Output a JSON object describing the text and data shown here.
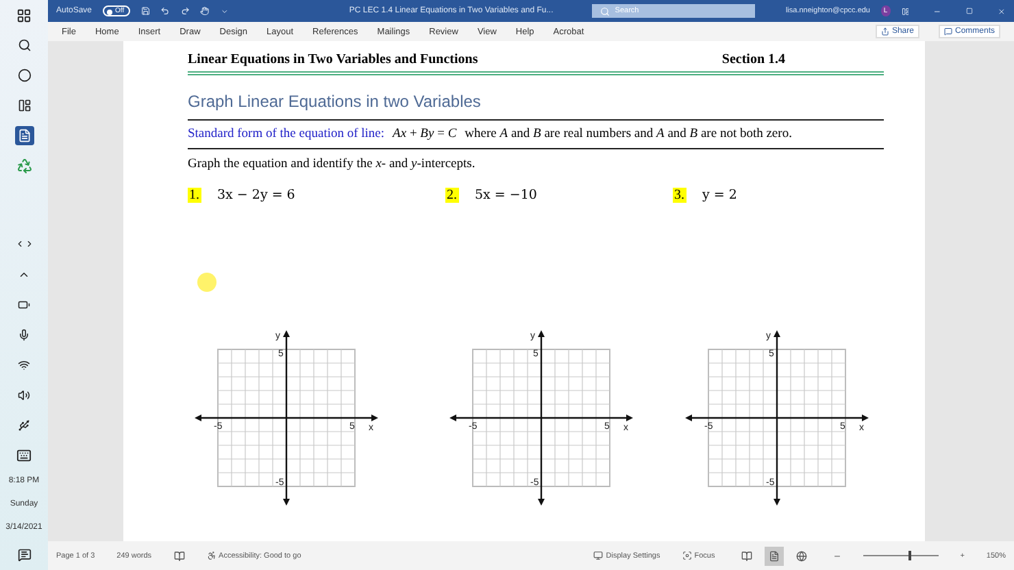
{
  "taskbar": {
    "time": "8:18 PM",
    "day": "Sunday",
    "date": "3/14/2021"
  },
  "title_bar": {
    "autosave": "AutoSave",
    "autosave_toggle": {
      "label": "Off",
      "on": false
    },
    "title": "PC LEC 1.4 Linear Equations in Two Variables and Fu...",
    "search": {
      "placeholder": "Search"
    },
    "account": "lisa.nneighton@cpcc.edu",
    "avatar": "L"
  },
  "menu": {
    "items": [
      {
        "label": "File",
        "selected": false
      },
      {
        "label": "Home",
        "selected": false
      },
      {
        "label": "Insert",
        "selected": false
      },
      {
        "label": "Draw",
        "selected": false
      },
      {
        "label": "Design",
        "selected": false
      },
      {
        "label": "Layout",
        "selected": false
      },
      {
        "label": "References",
        "selected": false
      },
      {
        "label": "Mailings",
        "selected": false
      },
      {
        "label": "Review",
        "selected": false
      },
      {
        "label": "View",
        "selected": false
      },
      {
        "label": "Help",
        "selected": false
      },
      {
        "label": "Acrobat",
        "selected": false
      }
    ],
    "share": "Share",
    "comments": "Comments"
  },
  "document": {
    "header_title": "Linear Equations in Two Variables and Functions",
    "header_section": "Section 1.4",
    "heading": "Graph Linear Equations in two Variables",
    "standard_form_label": "Standard form of the equation of line:",
    "standard_form_equation": "*Ax* + *By* = *C*",
    "standard_form_note": "where *A* and *B* are real numbers and *A* and *B* are not both zero.",
    "instruction": "Graph the equation and identify the *x*- and *y*-intercepts.",
    "problems": [
      {
        "number": "1.",
        "equation": "3x − 2y = 6"
      },
      {
        "number": "2.",
        "equation": "5x = −10"
      },
      {
        "number": "3.",
        "equation": "y = 2"
      }
    ],
    "graphs": [
      {
        "x_label": "x",
        "y_label": "y",
        "x_min": "-5",
        "x_max": "5",
        "y_min": "-5",
        "y_max": "5"
      },
      {
        "x_label": "x",
        "y_label": "y",
        "x_min": "-5",
        "x_max": "5",
        "y_min": "-5",
        "y_max": "5"
      },
      {
        "x_label": "x",
        "y_label": "y",
        "x_min": "-5",
        "x_max": "5",
        "y_min": "-5",
        "y_max": "5"
      }
    ]
  },
  "status_bar": {
    "page": "Page 1 of 3",
    "words": "249 words",
    "accessibility": "Accessibility: Good to go",
    "display_settings": "Display Settings",
    "focus": "Focus",
    "views": [
      {
        "kind": "read",
        "selected": false
      },
      {
        "kind": "print",
        "selected": true
      },
      {
        "kind": "web",
        "selected": false
      }
    ],
    "zoom": {
      "level": 0.6,
      "zoom_in": "+",
      "reading": "150%"
    }
  }
}
